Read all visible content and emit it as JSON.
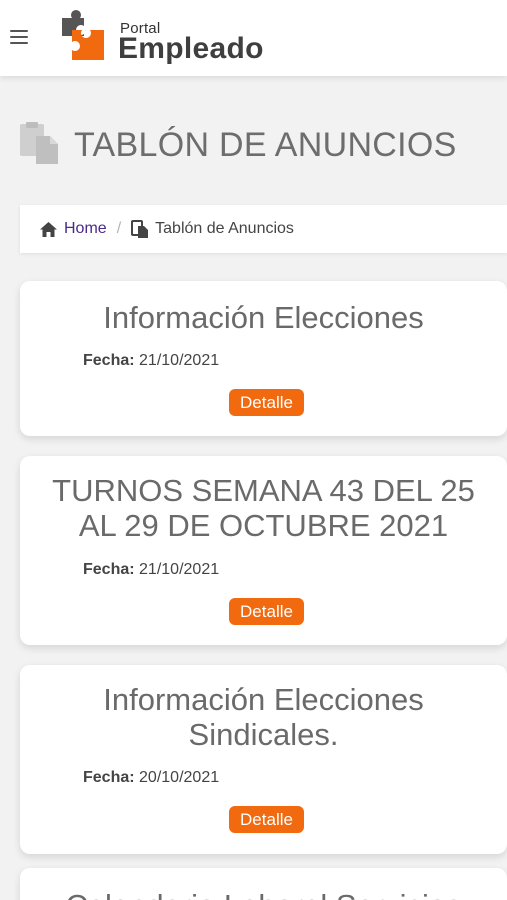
{
  "header": {
    "logo_small": "Portal",
    "logo_big": "Empleado",
    "brand_color": "#f26a10"
  },
  "page": {
    "title": "TABLÓN DE ANUNCIOS"
  },
  "breadcrumb": {
    "home": "Home",
    "separator": "/",
    "current": "Tablón de Anuncios"
  },
  "announcements": [
    {
      "title_lines": [
        "Información Elecciones"
      ],
      "date_label": "Fecha:",
      "date": "21/10/2021",
      "button": "Detalle"
    },
    {
      "title_lines": [
        "TURNOS SEMANA 43 DEL 25",
        "AL 29 DE OCTUBRE 2021"
      ],
      "date_label": "Fecha:",
      "date": "21/10/2021",
      "button": "Detalle"
    },
    {
      "title_lines": [
        "Información Elecciones",
        "Sindicales."
      ],
      "date_label": "Fecha:",
      "date": "20/10/2021",
      "button": "Detalle"
    },
    {
      "title_lines": [
        "Calendario Laboral Servicios"
      ]
    }
  ]
}
